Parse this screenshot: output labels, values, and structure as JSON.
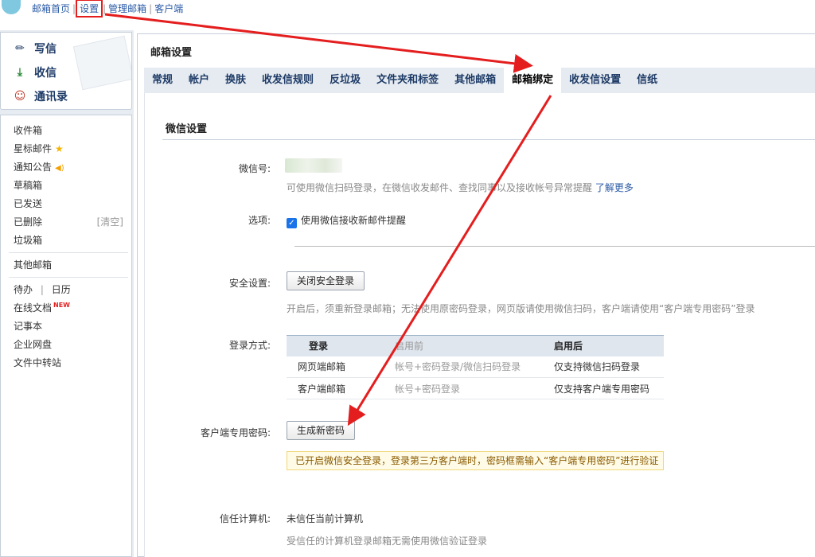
{
  "topnav": {
    "items": [
      "邮箱首页",
      "设置",
      "管理邮箱",
      "客户端"
    ],
    "separator": "|"
  },
  "quick": {
    "compose": "写信",
    "inbox": "收信",
    "contacts": "通讯录"
  },
  "folders": {
    "inbox": "收件箱",
    "starred": "星标邮件",
    "notice": "通知公告",
    "drafts": "草稿箱",
    "sent": "已发送",
    "deleted": "已删除",
    "clear": "[清空]",
    "spam": "垃圾箱",
    "other": "其他邮箱",
    "todo": "待办",
    "todo_sep": "|",
    "calendar": "日历",
    "docs": "在线文档",
    "new_tag": "NEW",
    "notes": "记事本",
    "disk": "企业网盘",
    "transfer": "文件中转站"
  },
  "main": {
    "title": "邮箱设置",
    "tabs": [
      "常规",
      "帐户",
      "换肤",
      "收发信规则",
      "反垃圾",
      "文件夹和标签",
      "其他邮箱",
      "邮箱绑定",
      "收发信设置",
      "信纸"
    ],
    "active_tab": "邮箱绑定"
  },
  "wechat": {
    "section_title": "微信设置",
    "id_label": "微信号:",
    "id_hint": "可使用微信扫码登录，在微信收发邮件、查找同事以及接收帐号异常提醒",
    "learn_more": "了解更多",
    "options_label": "选项:",
    "option_check": "使用微信接收新邮件提醒",
    "security_label": "安全设置:",
    "security_button": "关闭安全登录",
    "security_hint": "开启后，须重新登录邮箱；无法使用原密码登录，网页版请使用微信扫码，客户端请使用“客户端专用密码”登录",
    "login_label": "登录方式:",
    "table": {
      "headers": [
        "登录",
        "启用前",
        "启用后"
      ],
      "rows": [
        [
          "网页端邮箱",
          "帐号+密码登录/微信扫码登录",
          "仅支持微信扫码登录"
        ],
        [
          "客户端邮箱",
          "帐号+密码登录",
          "仅支持客户端专用密码"
        ]
      ]
    },
    "client_pw_label": "客户端专用密码:",
    "client_pw_button": "生成新密码",
    "client_pw_notice": "已开启微信安全登录，登录第三方客户端时，密码框需输入“客户端专用密码”进行验证",
    "trust_label": "信任计算机:",
    "trust_value": "未信任当前计算机",
    "trust_hint": "受信任的计算机登录邮箱无需使用微信验证登录"
  },
  "colors": {
    "accent": "#2a5aa6",
    "annotation": "#e41e1e",
    "tab_bar": "#e6ebf1"
  }
}
